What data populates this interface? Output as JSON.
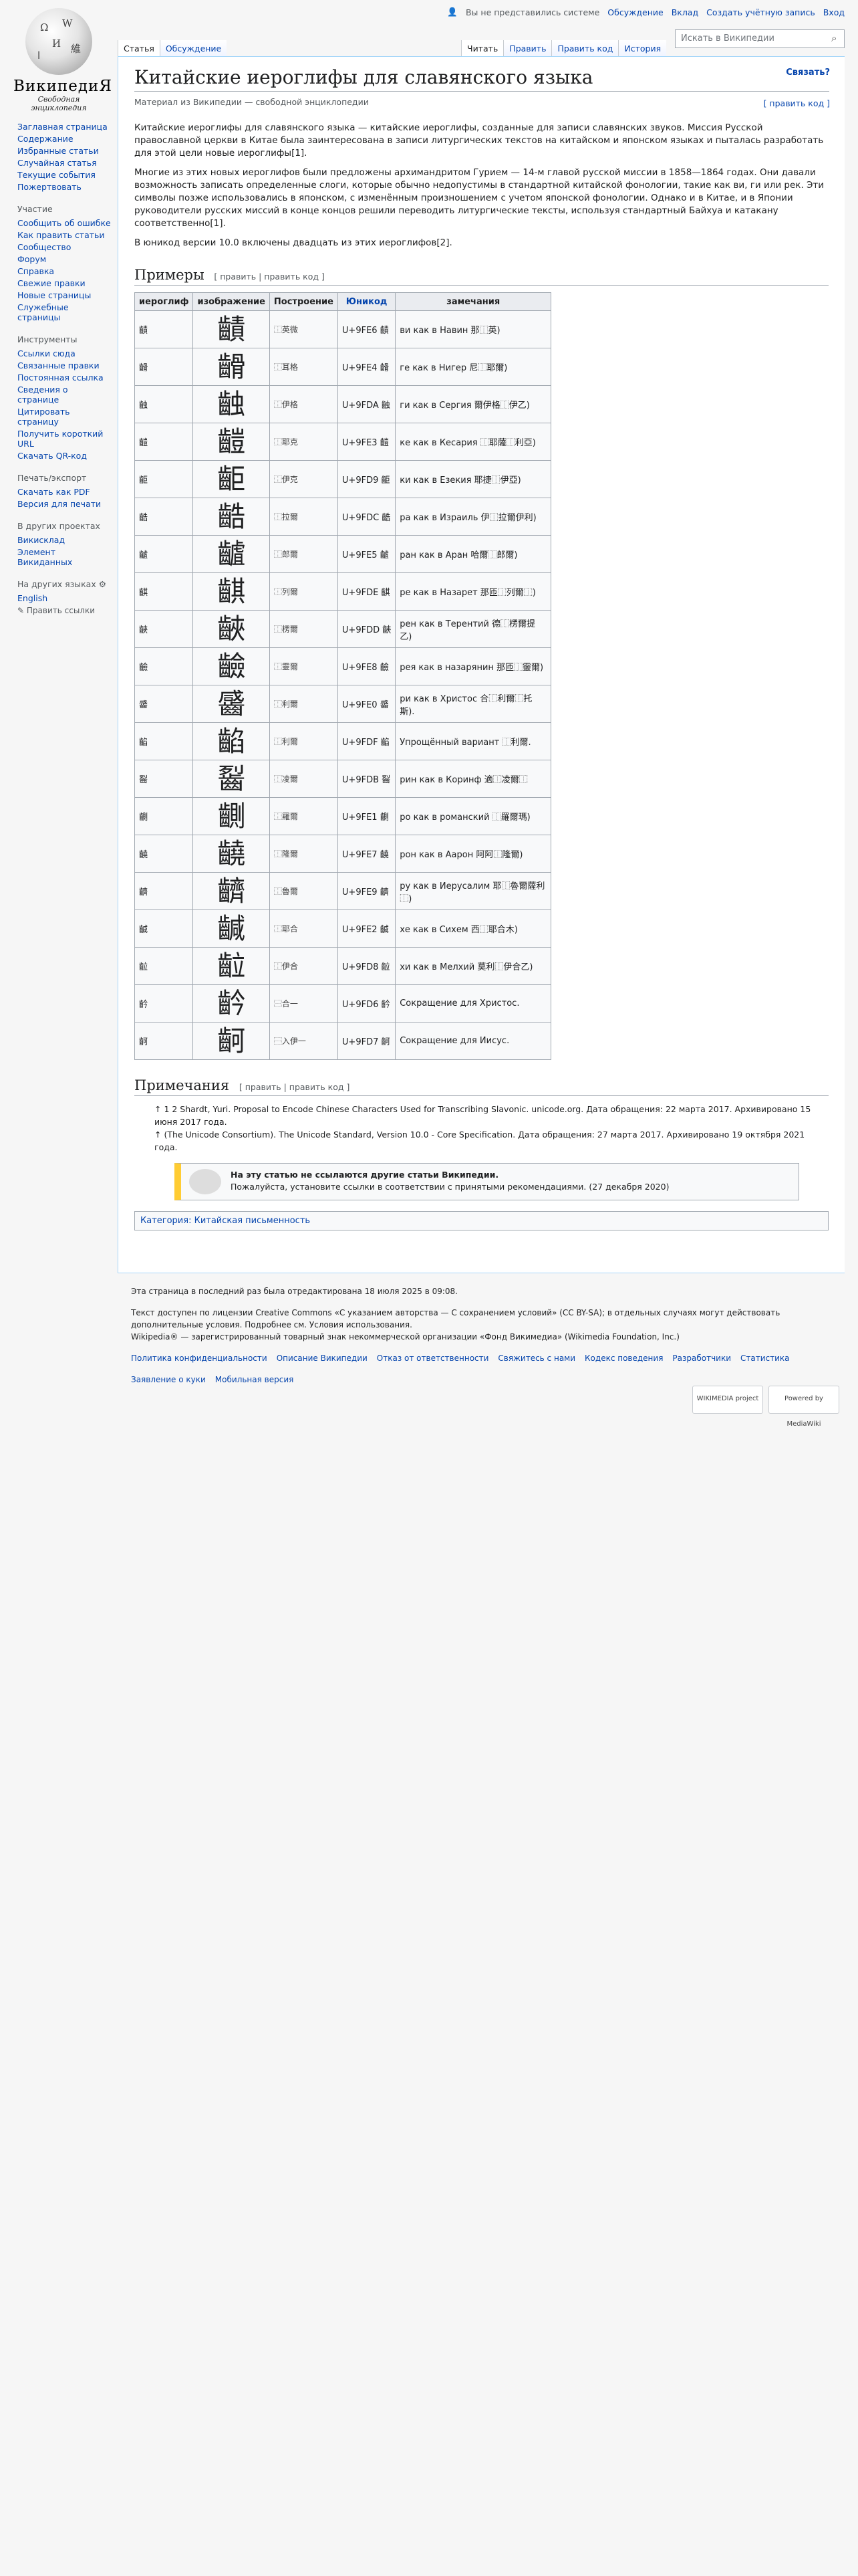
{
  "logo": {
    "wordmark": "ВикипедиЯ",
    "tagline": "Свободная энциклопедия"
  },
  "personal": {
    "notice": "Вы не представились системе",
    "discussion": "Обсуждение",
    "login": "Вход",
    "create": "Создать учётную запись",
    "contrib": "Вклад"
  },
  "tabs": {
    "article": "Статья",
    "talk": "Обсуждение",
    "read": "Читать",
    "edit": "Править",
    "editcode": "Править код",
    "history": "История"
  },
  "search": {
    "placeholder": "Искать в Википедии"
  },
  "sidebar": {
    "nav": [
      "Заглавная страница",
      "Содержание",
      "Избранные статьи",
      "Случайная статья",
      "Текущие события",
      "Пожертвовать"
    ],
    "part_h": "Участие",
    "part": [
      "Сообщить об ошибке",
      "Как править статьи",
      "Сообщество",
      "Форум",
      "Справка",
      "Свежие правки",
      "Новые страницы",
      "Служебные страницы"
    ],
    "tools_h": "Инструменты",
    "tools": [
      "Ссылки сюда",
      "Связанные правки",
      "Постоянная ссылка",
      "Сведения о странице",
      "Цитировать страницу",
      "Получить короткий URL",
      "Скачать QR-код"
    ],
    "print_h": "Печать/экспорт",
    "print": [
      "Скачать как PDF",
      "Версия для печати"
    ],
    "proj_h": "В других проектах",
    "proj": [
      "Викисклад",
      "Элемент Викиданных"
    ],
    "lang_h": "На других языках",
    "lang": [
      "English"
    ],
    "editlinks": "Править ссылки"
  },
  "article": {
    "title": "Китайские иероглифы для славянского языка",
    "connect": "Связать?",
    "sitesub": "Материал из Википедии — свободной энциклопедии",
    "editcode": "[ править код ]",
    "p1": "Китайские иероглифы для славянского языка — китайские иероглифы, созданные для записи славянских звуков. Миссия Русской православной церкви в Китае была заинтересована в записи литургических текстов на китайском и японском языках и пыталась разработать для этой цели новые иероглифы[1].",
    "p2": "Многие из этих новых иероглифов были предложены архимандритом Гурием — 14-м главой русской миссии в 1858—1864 годах. Они давали возможность записать определенные слоги, которые обычно недопустимы в стандартной китайской фонологии, такие как ви, ги или рек. Эти символы позже использовались в японском, с изменённым произношением с учетом японской фонологии. Однако и в Китае, и в Японии руководители русских миссий в конце концов решили переводить литургические тексты, используя стандартный Байхуа и катакану соответственно[1].",
    "p3": "В юникод версии 10.0 включены двадцать из этих иероглифов[2].",
    "sec_examples": "Примеры",
    "sec_edit": "[ править | править код ]",
    "columns": [
      "иероглиф",
      "изображение",
      "Построение",
      "Юникод",
      "замечания"
    ],
    "rows": [
      {
        "g": "䶦",
        "img": "䶦",
        "build": "⿰英微",
        "code": "U+9FE6 䶦",
        "note": "ви как в Навин 那⿰英)"
      },
      {
        "g": "䶤",
        "img": "䶤",
        "build": "⿰耳格",
        "code": "U+9FE4 䶤",
        "note": "ге как в Нигер 尼⿰耶爾)"
      },
      {
        "g": "䶚",
        "img": "䶚",
        "build": "⿰伊格",
        "code": "U+9FDA 䶚",
        "note": "ги как в Сергия 爾伊格⿰伊乙)"
      },
      {
        "g": "䶣",
        "img": "䶣",
        "build": "⿰耶克",
        "code": "U+9FE3 䶣",
        "note": "ке как в Кесария ⿰耶薩⿰利亞)"
      },
      {
        "g": "䶙",
        "img": "䶙",
        "build": "⿰伊克",
        "code": "U+9FD9 䶙",
        "note": "ки как в Езекия 耶捷⿰伊亞)"
      },
      {
        "g": "䶜",
        "img": "䶜",
        "build": "⿰拉爾",
        "code": "U+9FDC 䶜",
        "note": "ра как в Израиль 伊⿰拉爾伊利)"
      },
      {
        "g": "䶥",
        "img": "䶥",
        "build": "⿰郎爾",
        "code": "U+9FE5 䶥",
        "note": "ран как в Аран 哈爾⿰郎爾)"
      },
      {
        "g": "䶞",
        "img": "䶞",
        "build": "⿰列爾",
        "code": "U+9FDE 䶞",
        "note": "ре как в Назарет 那匝⿰列爾⿰)"
      },
      {
        "g": "䶝",
        "img": "䶝",
        "build": "⿰楞爾",
        "code": "U+9FDD 䶝",
        "note": "рен как в Терентий 德⿰楞爾提乙)"
      },
      {
        "g": "䶨",
        "img": "䶨",
        "build": "⿰靈爾",
        "code": "U+9FE8 䶨",
        "note": "рея как в назарянин 那匝⿰靈爾)"
      },
      {
        "g": "䶠",
        "img": "䶠",
        "build": "⿰利爾",
        "code": "U+9FE0 䶠",
        "note": "ри как в Христос 合⿰利爾⿰托斯)."
      },
      {
        "g": "䶟",
        "img": "䶟",
        "build": "⿰利爾",
        "code": "U+9FDF 䶟",
        "note": "Упрощённый вариант ⿰利爾."
      },
      {
        "g": "䶛",
        "img": "䶛",
        "build": "⿰凌爾",
        "code": "U+9FDB 䶛",
        "note": "рин как в Коринф 適⿰凌爾⿰"
      },
      {
        "g": "䶡",
        "img": "䶡",
        "build": "⿰羅爾",
        "code": "U+9FE1 䶡",
        "note": "ро как в романский ⿰羅爾瑪)"
      },
      {
        "g": "䶧",
        "img": "䶧",
        "build": "⿰隆爾",
        "code": "U+9FE7 䶧",
        "note": "рон как в Аарон 阿阿⿰隆爾)"
      },
      {
        "g": "䶩",
        "img": "䶩",
        "build": "⿰魯爾",
        "code": "U+9FE9 䶩",
        "note": "ру как в Иерусалим 耶⿰魯爾薩利⿰)"
      },
      {
        "g": "䶢",
        "img": "䶢",
        "build": "⿰耶合",
        "code": "U+9FE2 䶢",
        "note": "хе как в Сихем 西⿰耶合木)"
      },
      {
        "g": "䶘",
        "img": "䶘",
        "build": "⿰伊合",
        "code": "U+9FD8 䶘",
        "note": "хи как в Мелхий 莫利⿰伊合乙)"
      },
      {
        "g": "䶖",
        "img": "䶖",
        "build": "⿱合一",
        "code": "U+9FD6 䶖",
        "note": "Сокращение для Христос."
      },
      {
        "g": "䶗",
        "img": "䶗",
        "build": "⿱入伊一",
        "code": "U+9FD7 䶗",
        "note": "Сокращение для Иисус."
      }
    ],
    "sec_notes": "Примечания",
    "ref1": "↑ 1 2 Shardt, Yuri. Proposal to Encode Chinese Characters Used for Transcribing Slavonic. unicode.org. Дата обращения: 22 марта 2017. Архивировано 15 июня 2017 года.",
    "ref2": "↑ (The Unicode Consortium). The Unicode Standard, Version 10.0 - Core Specification. Дата обращения: 27 марта 2017. Архивировано 19 октября 2021 года.",
    "ambox_title": "На эту статью не ссылаются другие статьи Википедии.",
    "ambox_text": "Пожалуйста, установите ссылки в соответствии с принятыми рекомендациями. (27 декабря 2020)",
    "category": "Категория: Китайская письменность"
  },
  "footer": {
    "edited": "Эта страница в последний раз была отредактирована 18 июля 2025 в 09:08.",
    "license": "Текст доступен по лицензии Creative Commons «С указанием авторства — С сохранением условий» (CC BY-SA); в отдельных случаях могут действовать дополнительные условия. Подробнее см. Условия использования.",
    "trademark": "Wikipedia® — зарегистрированный товарный знак некоммерческой организации «Фонд Викимедиа» (Wikimedia Foundation, Inc.)",
    "links": [
      "Политика конфиденциальности",
      "Описание Википедии",
      "Отказ от ответственности",
      "Свяжитесь с нами",
      "Кодекс поведения",
      "Разработчики",
      "Статистика"
    ],
    "links2": [
      "Заявление о куки",
      "Мобильная версия"
    ],
    "badge1": "WIKIMEDIA project",
    "badge2": "Powered by MediaWiki"
  }
}
